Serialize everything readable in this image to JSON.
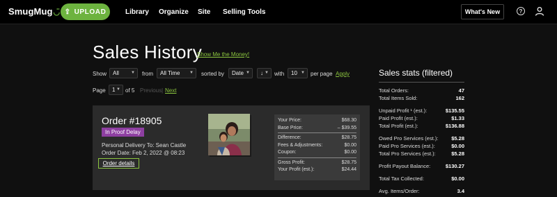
{
  "nav": {
    "logo": "SmugMug",
    "upload_label": "UPLOAD",
    "links": [
      "Library",
      "Organize",
      "Site",
      "Selling Tools"
    ],
    "whats_new": "What's New",
    "help_glyph": "?"
  },
  "page": {
    "title": "Sales History",
    "money_link": "Show Me the Money!"
  },
  "filters": {
    "show_label": "Show",
    "show_value": "All",
    "from_label": "from",
    "from_value": "All Time",
    "sorted_label": "sorted by",
    "sorted_value": "Date",
    "sort_dir_value": "↓",
    "with_label": "with",
    "per_page_value": "10",
    "per_page_label": "per page",
    "apply": "Apply",
    "page_label": "Page",
    "page_value": "1",
    "of_label": "of 5",
    "previous": "Previous",
    "pipe": "|",
    "next": "Next"
  },
  "order": {
    "title": "Order #18905",
    "status": "In Proof Delay",
    "delivery": "Personal Delivery To: Sean Castle",
    "date": "Order Date: Feb 2, 2022 @ 08:23",
    "details": "Order details",
    "prices": {
      "group1": [
        {
          "label": "Your Price:",
          "value": "$68.30"
        },
        {
          "label": "Base Price:",
          "value": "– $39.55"
        }
      ],
      "group2": [
        {
          "label": "Difference:",
          "value": "$28.75"
        },
        {
          "label": "Fees & Adjustments:",
          "value": "$0.00"
        },
        {
          "label": "Coupon:",
          "value": "$0.00"
        }
      ],
      "group3": [
        {
          "label": "Gross Profit:",
          "value": "$28.75"
        },
        {
          "label": "Your Profit (est.):",
          "value": "$24.44"
        }
      ]
    }
  },
  "stats": {
    "title": "Sales stats (filtered)",
    "rows": [
      {
        "label": "Total Orders:",
        "value": "47"
      },
      {
        "label": "Total Items Sold:",
        "value": "162"
      },
      {
        "label": "Unpaid Profit ¹ (est.):",
        "value": "$135.55"
      },
      {
        "label": "Paid Profit (est.):",
        "value": "$1.33"
      },
      {
        "label": "Total Profit (est.):",
        "value": "$136.88"
      },
      {
        "label": "Owed Pro Services (est.):",
        "value": "$5.28"
      },
      {
        "label": "Paid Pro Services (est.):",
        "value": "$0.00"
      },
      {
        "label": "Total Pro Services (est.):",
        "value": "$5.28"
      },
      {
        "label": "Profit Payout Balance:",
        "value": "$130.27"
      },
      {
        "label": "Total Tax Collected:",
        "value": "$0.00"
      },
      {
        "label": "Avg. Items/Order:",
        "value": "3.4"
      }
    ]
  },
  "colors": {
    "accent": "#6db33f",
    "link": "#8cc63f",
    "badge": "#8e3fa1",
    "background": "#101010",
    "card": "#2b2b2b"
  }
}
